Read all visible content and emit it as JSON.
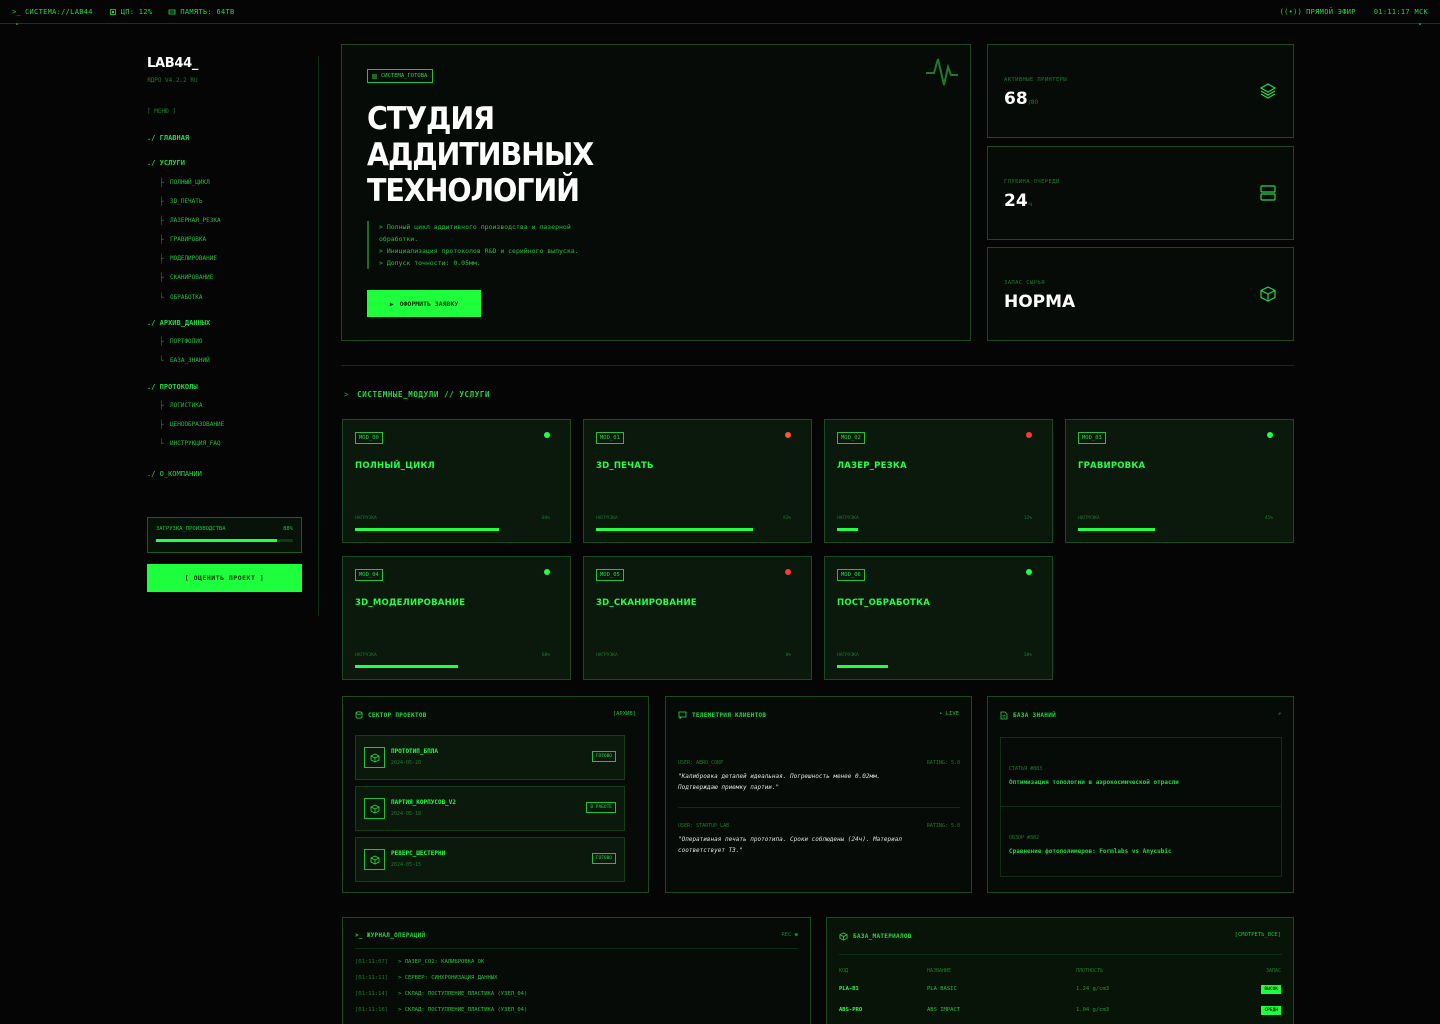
{
  "topbar": {
    "system": "СИСТЕМА://LAB44",
    "cpu": "ЦП: 12%",
    "memory": "ПАМЯТЬ: 64TB",
    "live": "ПРЯМОЙ ЭФИР",
    "time": "01:11:17 МСК"
  },
  "sidebar": {
    "logo": "LAB44_",
    "core": "ЯДРО V4.2.2 RU",
    "menu_header": "[ МЕНЮ ]",
    "home": "./ ГЛАВНАЯ",
    "services": "./ УСЛУГИ",
    "services_items": [
      "ПОЛНЫЙ_ЦИКЛ",
      "3D_ПЕЧАТЬ",
      "ЛАЗЕРНАЯ_РЕЗКА",
      "ГРАВИРОВКА",
      "МОДЕЛИРОВАНИЕ",
      "СКАНИРОВАНИЕ",
      "ОБРАБОТКА"
    ],
    "archive": "./ АРХИВ_ДАННЫХ",
    "archive_items": [
      "ПОРТФОЛИО",
      "БАЗА_ЗНАНИЙ"
    ],
    "protocols": "./ ПРОТОКОЛЫ",
    "protocols_items": [
      "ЛОГИСТИКА",
      "ЦЕНООБРАЗОВАНИЕ",
      "ИНСТРУКЦИЯ_FAQ"
    ],
    "about": "./ О_КОМПАНИИ",
    "load_label": "ЗАГРУЗКА_ПРОИЗВОДСТВА",
    "load_percent": "88%",
    "load_value": 0.88,
    "cta": "[ ОЦЕНИТЬ ПРОЕКТ ]"
  },
  "hero": {
    "badge": "СИСТЕМА_ГОТОВА",
    "title_1": "СТУДИЯ",
    "title_2": "АДДИТИВНЫХ",
    "title_3": "ТЕХНОЛОГИЙ",
    "desc_1": "> Полный цикл аддитивного производства и лазерной",
    "desc_2": "обработки.",
    "desc_3": "> Инициализация протоколов R&D и серийного выпуска.",
    "desc_4": "> Допуск точности: 0.05мм.",
    "button": "ОФОРМИТЬ ЗАЯВКУ"
  },
  "stats": [
    {
      "label": "АКТИВНЫЕ ПРИНТЕРЫ",
      "value": "68",
      "unit": "/80",
      "icon": "layers-icon"
    },
    {
      "label": "ГЛУБИНА ОЧЕРЕДИ",
      "value": "24",
      "unit": "ч",
      "icon": "server-icon"
    },
    {
      "label": "ЗАПАС СЫРЬЯ",
      "value": "НОРМА",
      "unit": "",
      "icon": "box-icon"
    }
  ],
  "modules_title": "СИСТЕМНЫЕ_МОДУЛИ // УСЛУГИ",
  "load_label": "НАГРУЗКА",
  "modules": [
    {
      "tag": "MOD_00",
      "name": "ПОЛНЫЙ_ЦИКЛ",
      "load": "84%",
      "value": 0.84,
      "status_color": "#22ff44"
    },
    {
      "tag": "MOD_01",
      "name": "3D_ПЕЧАТЬ",
      "load": "92%",
      "value": 0.92,
      "status_color": "#ff5a1f"
    },
    {
      "tag": "MOD_02",
      "name": "ЛАЗЕР_РЕЗКА",
      "load": "12%",
      "value": 0.12,
      "status_color": "#ff3b2f"
    },
    {
      "tag": "MOD_03",
      "name": "ГРАВИРОВКА",
      "load": "45%",
      "value": 0.45,
      "status_color": "#22ff44"
    },
    {
      "tag": "MOD_04",
      "name": "3D_МОДЕЛИРОВАНИЕ",
      "load": "60%",
      "value": 0.6,
      "status_color": "#22ff44"
    },
    {
      "tag": "MOD_05",
      "name": "3D_СКАНИРОВАНИЕ",
      "load": "0%",
      "value": 0.0,
      "status_color": "#ff3b2f"
    },
    {
      "tag": "MOD_06",
      "name": "ПОСТ_ОБРАБОТКА",
      "load": "30%",
      "value": 0.3,
      "status_color": "#22ff44"
    }
  ],
  "projects": {
    "title": "СЕКТОР ПРОЕКТОВ",
    "link": "[АРХИВ]",
    "items": [
      {
        "name": "ПРОТОТИП_БПЛА",
        "date": "2024-05-20",
        "status": "ГОТОВО"
      },
      {
        "name": "ПАРТИЯ_КОРПУСОВ_V2",
        "date": "2024-05-18",
        "status": "В РАБОТЕ"
      },
      {
        "name": "РЕВЕРС_ШЕСТЕРНИ",
        "date": "2024-05-15",
        "status": "ГОТОВО"
      }
    ]
  },
  "telemetry": {
    "title": "ТЕЛЕМЕТРИЯ КЛИЕНТОВ",
    "live": "• LIVE",
    "items": [
      {
        "user": "USER: AERO_CORP",
        "rating": "RATING: 5.0",
        "q1": "\"Калибровка деталей идеальная. Погрешность менее 0.02мм.",
        "q2": "Подтверждаю приемку партии.\""
      },
      {
        "user": "USER: STARTUP_LAB",
        "rating": "RATING: 5.0",
        "q1": "\"Оперативная печать прототипа. Сроки соблюдены (24ч). Материал",
        "q2": "соответствует ТЗ.\""
      }
    ]
  },
  "knowledge": {
    "title": "БАЗА ЗНАНИЙ",
    "arrow": "↗",
    "items": [
      {
        "meta": "СТАТЬЯ #883",
        "title": "Оптимизация топологии в аэрокосмической отрасли"
      },
      {
        "meta": "ОБЗОР #882",
        "title": "Сравнение фотополимеров: Formlabs vs Anycubic"
      }
    ]
  },
  "oplog": {
    "title": ">_ ЖУРНАЛ_ОПЕРАЦИЙ",
    "rec": "REC ●",
    "rows": [
      {
        "ts": "[01:11:07]",
        "msg": "> ЛАЗЕР_CO2: КАЛИБРОВКА ОК"
      },
      {
        "ts": "[01:11:11]",
        "msg": "> СЕРВЕР: СИНХРОНИЗАЦИЯ ДАННЫХ"
      },
      {
        "ts": "[01:11:14]",
        "msg": "> СКЛАД: ПОСТУПЛЕНИЕ_ПЛАСТИКА (УЗЕЛ_04)"
      },
      {
        "ts": "[01:11:16]",
        "msg": "> СКЛАД: ПОСТУПЛЕНИЕ_ПЛАСТИКА (УЗЕЛ_04)"
      }
    ]
  },
  "materials": {
    "title": "БАЗА_МАТЕРИАЛОВ",
    "link": "[СМОТРЕТЬ_ВСЕ]",
    "headers": [
      "КОД",
      "НАЗВАНИЕ",
      "ПЛОТНОСТЬ",
      "ЗАПАС"
    ],
    "rows": [
      {
        "code": "PLA-B1",
        "name": "PLA BASIC",
        "density": "1.24 g/cm3",
        "stock": "ВЫСОК"
      },
      {
        "code": "ABS-PRO",
        "name": "ABS IMPACT",
        "density": "1.04 g/cm3",
        "stock": "СРЕДН"
      }
    ]
  }
}
